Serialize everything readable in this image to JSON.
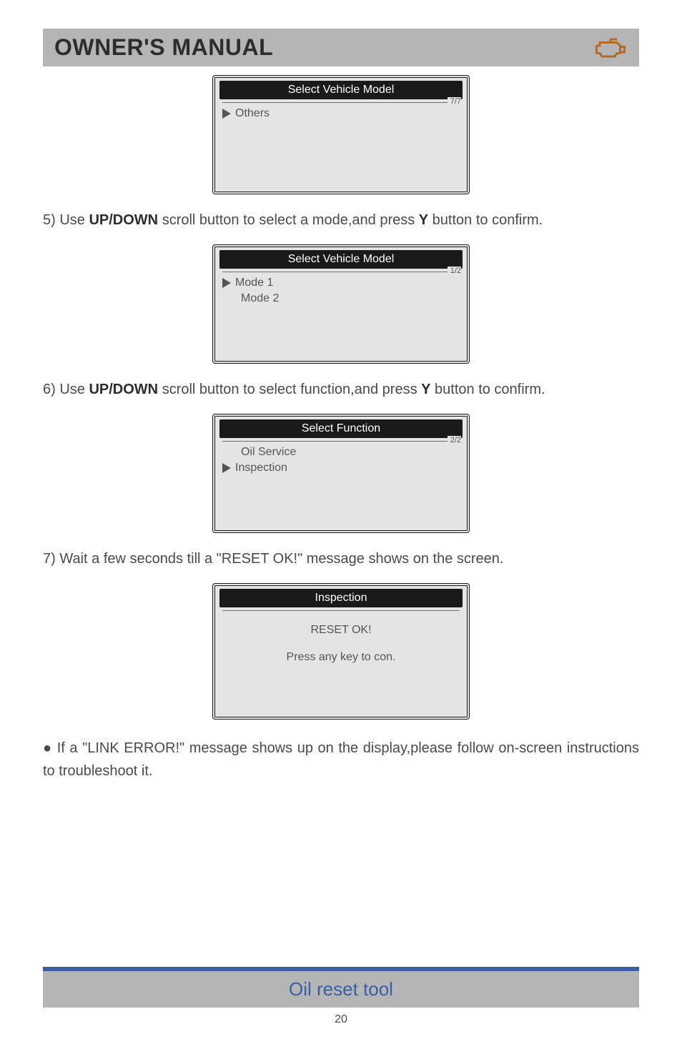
{
  "header": {
    "title": "OWNER'S MANUAL"
  },
  "screens": {
    "s1": {
      "title": "Select Vehicle Model",
      "page": "7/7",
      "item1": "Others"
    },
    "s2": {
      "title": "Select Vehicle Model",
      "page": "1/2",
      "item1": "Mode 1",
      "item2": "Mode 2"
    },
    "s3": {
      "title": "Select Function",
      "page": "2/2",
      "item1": "Oil Service",
      "item2": "Inspection"
    },
    "s4": {
      "title": "Inspection",
      "line1": "RESET OK!",
      "line2": "Press any key to con."
    }
  },
  "paras": {
    "p5a": "5) Use ",
    "p5b": "UP/DOWN",
    "p5c": " scroll button to select a mode,and press ",
    "p5d": "Y",
    "p5e": " button to confirm.",
    "p6a": "6) Use ",
    "p6b": "UP/DOWN",
    "p6c": " scroll button to select function,and press ",
    "p6d": "Y",
    "p6e": " button to confirm.",
    "p7": "7) Wait a few seconds till a \"RESET OK!\" message shows on the screen.",
    "bullet": "● If a \"LINK ERROR!\" message shows up on the display,please follow on-screen instructions to troubleshoot it."
  },
  "footer": {
    "title": "Oil reset tool",
    "page_num": "20"
  }
}
